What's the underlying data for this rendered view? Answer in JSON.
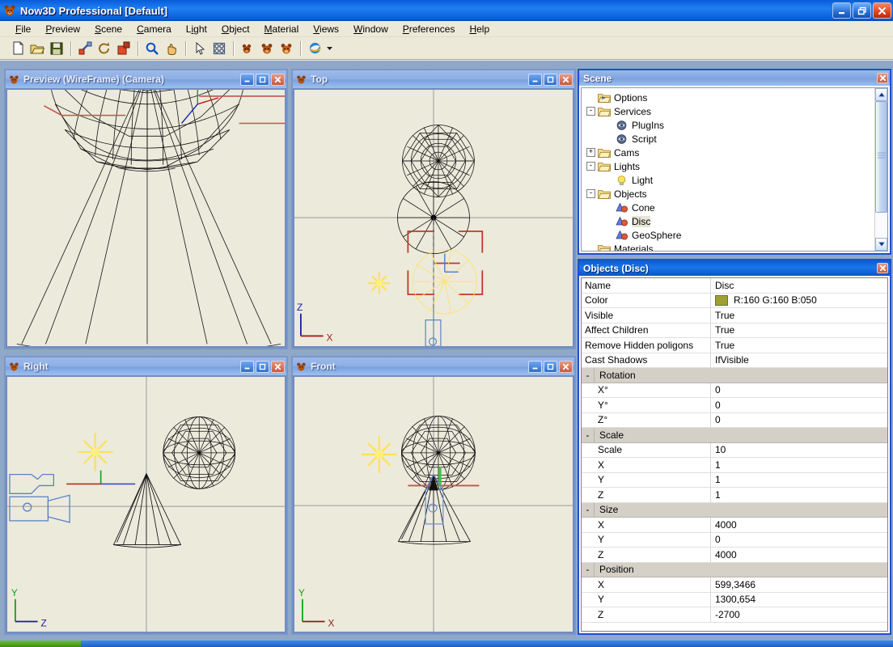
{
  "window": {
    "title": "Now3D Professional [Default]",
    "app_icon": "bear-icon",
    "buttons": [
      {
        "name": "minimize-button",
        "glyph": "minimize"
      },
      {
        "name": "restore-button",
        "glyph": "restore"
      },
      {
        "name": "close-button",
        "glyph": "close"
      }
    ]
  },
  "menubar": {
    "items": [
      {
        "label": "File",
        "accel": "F"
      },
      {
        "label": "Preview",
        "accel": "P"
      },
      {
        "label": "Scene",
        "accel": "S"
      },
      {
        "label": "Camera",
        "accel": "C"
      },
      {
        "label": "Light",
        "accel": "i"
      },
      {
        "label": "Object",
        "accel": "O"
      },
      {
        "label": "Material",
        "accel": "M"
      },
      {
        "label": "Views",
        "accel": "V"
      },
      {
        "label": "Window",
        "accel": "W"
      },
      {
        "label": "Preferences",
        "accel": "P"
      },
      {
        "label": "Help",
        "accel": "H"
      }
    ]
  },
  "toolbar": {
    "items": [
      {
        "name": "new-document-icon",
        "tip": "New"
      },
      {
        "name": "open-folder-icon",
        "tip": "Open"
      },
      {
        "name": "save-disk-icon",
        "tip": "Save"
      },
      {
        "name": "move-tool-icon",
        "tip": "Move"
      },
      {
        "name": "rotate-tool-icon",
        "tip": "Rotate"
      },
      {
        "name": "scale-tool-icon",
        "tip": "Scale"
      },
      {
        "name": "zoom-magnifier-icon",
        "tip": "Zoom"
      },
      {
        "name": "pan-hand-icon",
        "tip": "Pan"
      },
      {
        "name": "select-arrow-icon",
        "tip": "Select"
      },
      {
        "name": "grid-icon",
        "tip": "Grid"
      },
      {
        "name": "render-bear-icon",
        "tip": "Render"
      },
      {
        "name": "render-bears-icon",
        "tip": "Render All"
      },
      {
        "name": "render-bears-alt-icon",
        "tip": "Batch Render"
      },
      {
        "name": "browser-icon",
        "tip": "Web"
      },
      {
        "name": "dropdown-arrow-icon",
        "tip": "More"
      }
    ]
  },
  "viewports": [
    {
      "title": "Preview (WireFrame) (Camera)",
      "name": "viewport-preview",
      "active": false,
      "axes": null
    },
    {
      "title": "Top",
      "name": "viewport-top",
      "active": false,
      "axes": {
        "v": "Z",
        "h": "X",
        "v_color": "#0000cc",
        "h_color": "#cc0000"
      }
    },
    {
      "title": "Right",
      "name": "viewport-right",
      "active": false,
      "axes": {
        "v": "Y",
        "h": "Z",
        "v_color": "#00aa00",
        "h_color": "#0000cc"
      }
    },
    {
      "title": "Front",
      "name": "viewport-front",
      "active": false,
      "axes": {
        "v": "Y",
        "h": "X",
        "v_color": "#00aa00",
        "h_color": "#aa0000"
      }
    }
  ],
  "viewport_buttons": [
    {
      "name": "minimize-button",
      "glyph": "minimize"
    },
    {
      "name": "maximize-button",
      "glyph": "maximize"
    },
    {
      "name": "close-button",
      "glyph": "close"
    }
  ],
  "scene_panel": {
    "title": "Scene",
    "close_label": "close-icon",
    "tree": [
      {
        "label": "Options",
        "depth": 1,
        "expander": "",
        "icon": "options-folder-icon",
        "selected": false
      },
      {
        "label": "Services",
        "depth": 1,
        "expander": "-",
        "icon": "folder-icon",
        "selected": false
      },
      {
        "label": "PlugIns",
        "depth": 2,
        "expander": "",
        "icon": "plug-icon",
        "selected": false
      },
      {
        "label": "Script",
        "depth": 2,
        "expander": "",
        "icon": "plug-icon",
        "selected": false
      },
      {
        "label": "Cams",
        "depth": 1,
        "expander": "+",
        "icon": "folder-icon",
        "selected": false
      },
      {
        "label": "Lights",
        "depth": 1,
        "expander": "-",
        "icon": "folder-icon",
        "selected": false
      },
      {
        "label": "Light",
        "depth": 2,
        "expander": "",
        "icon": "lightbulb-icon",
        "selected": false
      },
      {
        "label": "Objects",
        "depth": 1,
        "expander": "-",
        "icon": "folder-icon",
        "selected": false
      },
      {
        "label": "Cone",
        "depth": 2,
        "expander": "",
        "icon": "object-icon",
        "selected": false
      },
      {
        "label": "Disc",
        "depth": 2,
        "expander": "",
        "icon": "object-icon",
        "selected": true
      },
      {
        "label": "GeoSphere",
        "depth": 2,
        "expander": "",
        "icon": "object-icon",
        "selected": false
      },
      {
        "label": "Materials",
        "depth": 1,
        "expander": "",
        "icon": "folder-icon",
        "selected": false
      }
    ]
  },
  "objects_panel": {
    "title": "Objects (Disc)",
    "close_label": "close-icon",
    "rows": [
      {
        "kind": "row",
        "name": "Name",
        "value": "Disc"
      },
      {
        "kind": "color",
        "name": "Color",
        "value": "R:160 G:160 B:050",
        "swatch": "#a0a032"
      },
      {
        "kind": "row",
        "name": "Visible",
        "value": "True"
      },
      {
        "kind": "row",
        "name": "Affect Children",
        "value": "True"
      },
      {
        "kind": "row",
        "name": "Remove Hidden poligons",
        "value": "True"
      },
      {
        "kind": "row",
        "name": "Cast Shadows",
        "value": "IfVisible"
      },
      {
        "kind": "group",
        "name": "Rotation",
        "expander": "-"
      },
      {
        "kind": "sub",
        "name": "X°",
        "value": "0"
      },
      {
        "kind": "sub",
        "name": "Y°",
        "value": "0"
      },
      {
        "kind": "sub",
        "name": "Z°",
        "value": "0"
      },
      {
        "kind": "group",
        "name": "Scale",
        "expander": "-"
      },
      {
        "kind": "sub",
        "name": "Scale",
        "value": "10"
      },
      {
        "kind": "sub",
        "name": "X",
        "value": "1"
      },
      {
        "kind": "sub",
        "name": "Y",
        "value": "1"
      },
      {
        "kind": "sub",
        "name": "Z",
        "value": "1"
      },
      {
        "kind": "group",
        "name": "Size",
        "expander": "-"
      },
      {
        "kind": "sub",
        "name": "X",
        "value": "4000"
      },
      {
        "kind": "sub",
        "name": "Y",
        "value": "0"
      },
      {
        "kind": "sub",
        "name": "Z",
        "value": "4000"
      },
      {
        "kind": "group",
        "name": "Position",
        "expander": "-"
      },
      {
        "kind": "sub",
        "name": "X",
        "value": "599,3466"
      },
      {
        "kind": "sub",
        "name": "Y",
        "value": "1300,654"
      },
      {
        "kind": "sub",
        "name": "Z",
        "value": "-2700"
      }
    ]
  },
  "colors": {
    "titlebar_active": "#0a5ad4",
    "titlebar_inactive": "#8fb0e6",
    "app_face": "#ece9d8",
    "viewport_bg": "#eceadb",
    "workspace": "#8fa8c8",
    "selection_red": "#cc3322",
    "light_yellow": "#ffee33",
    "camera_blue": "#6a8fd0"
  }
}
